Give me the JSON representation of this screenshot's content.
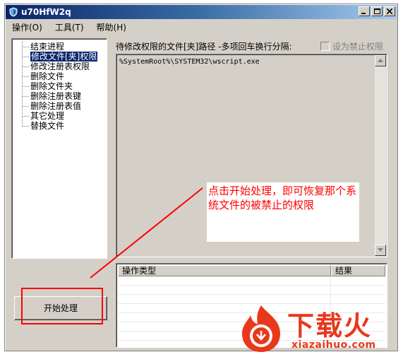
{
  "window": {
    "title": "u70HfW2q"
  },
  "menu": {
    "items": [
      "操作(O)",
      "工具(T)",
      "帮助(H)"
    ]
  },
  "tree": {
    "items": [
      {
        "label": "结束进程",
        "selected": false
      },
      {
        "label": "修改文件[夹]权限",
        "selected": true
      },
      {
        "label": "修改注册表权限",
        "selected": false
      },
      {
        "label": "删除文件",
        "selected": false
      },
      {
        "label": "删除文件夹",
        "selected": false
      },
      {
        "label": "删除注册表键",
        "selected": false
      },
      {
        "label": "删除注册表值",
        "selected": false
      },
      {
        "label": "其它处理",
        "selected": false
      },
      {
        "label": "替换文件",
        "selected": false
      }
    ]
  },
  "path_section": {
    "label": "待修改权限的文件[夹]路径 -多项回车换行分隔:",
    "checkbox_label": "设为禁止权限",
    "value": "%SystemRoot%\\SYSTEM32\\wscript.exe"
  },
  "annotation": {
    "text": "点击开始处理，即可恢复那个系统文件的被禁止的权限"
  },
  "op_table": {
    "columns": [
      "操作类型",
      "结果"
    ]
  },
  "start_button": {
    "label": "开始处理"
  },
  "watermark": {
    "brand": "下载火",
    "url": "xiazaihuo.com"
  },
  "colors": {
    "annotation": "#ff0000",
    "titlebar": "#0a246a",
    "selection": "#0a246a",
    "watermark": "#e8381c"
  }
}
